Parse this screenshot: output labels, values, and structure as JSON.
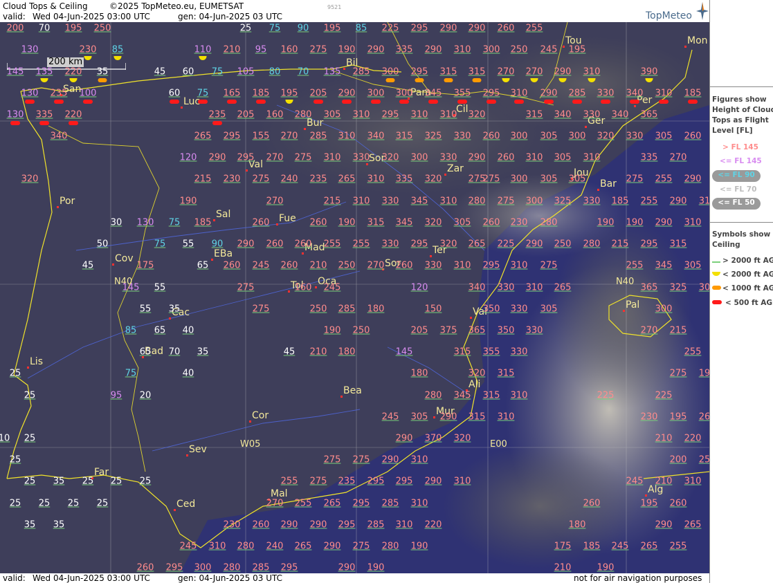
{
  "header": {
    "product": "Cloud Tops & Ceiling",
    "copyright": "©2025 TopMeteo.eu, EUMETSAT",
    "code": "9521",
    "valid_label": "valid:",
    "valid_time": "Wed  04-Jun-2025  03:00 UTC",
    "gen_time": "gen: 04-Jun-2025 03 UTC",
    "logo": "TopMeteo"
  },
  "footer": {
    "valid_label": "valid:",
    "valid_time": "Wed  04-Jun-2025  03:00 UTC",
    "gen_time": "gen: 04-Jun-2025 03 UTC",
    "disclaimer": "not for air navigation purposes"
  },
  "scale": {
    "label": "200 km"
  },
  "legend": {
    "figures_title": [
      "Figures show",
      "Height of Cloud",
      "Tops as Flight",
      "Level  [FL]"
    ],
    "figures": [
      {
        "label": "> FL 145",
        "color": "#ff8c8c"
      },
      {
        "label": "<= FL 145",
        "color": "#d88cf0"
      },
      {
        "label": "<= FL 90",
        "color": "#5fd4e6"
      },
      {
        "label": "<= FL 70",
        "color": "#dddddd"
      },
      {
        "label": "<= FL 50",
        "color": "#ffffff"
      }
    ],
    "symbols_title": [
      "Symbols show",
      "Ceiling"
    ],
    "symbols": [
      {
        "label": "> 2000 ft AGL",
        "kind": "line",
        "color": "#7bd07b"
      },
      {
        "label": "< 2000 ft AGL",
        "kind": "half-disc",
        "color": "#f3e000"
      },
      {
        "label": "< 1000 ft AGL",
        "kind": "bar",
        "color": "#ff9a00"
      },
      {
        "label": "< 500 ft AGL",
        "kind": "bar",
        "color": "#ff1a1a"
      }
    ]
  },
  "grid_labels": [
    "N40",
    "N40",
    "W05",
    "E00"
  ],
  "cities": [
    "Bil",
    "Pam",
    "San",
    "Luc",
    "Bur",
    "Cil",
    "Per",
    "Ger",
    "Mon",
    "Tou",
    "Sor",
    "Val",
    "Zar",
    "Jou",
    "Bar",
    "Por",
    "Sal",
    "Fue",
    "Mad",
    "EBa",
    "Cov",
    "Ter",
    "Sor",
    "Tol",
    "Oca",
    "Cac",
    "Val",
    "Pal",
    "Bad",
    "Lis",
    "Ali",
    "Bea",
    "Mur",
    "Cor",
    "Sev",
    "Far",
    "Mal",
    "Alg",
    "Ced"
  ],
  "flight_levels": [
    [
      "200",
      "pink"
    ],
    [
      "70",
      "white"
    ],
    [
      "195",
      "pink"
    ],
    [
      "250",
      "pink"
    ],
    [
      "25",
      "white"
    ],
    [
      "75",
      "cyan"
    ],
    [
      "90",
      "cyan"
    ],
    [
      "195",
      "pink"
    ],
    [
      "85",
      "cyan"
    ],
    [
      "225",
      "pink"
    ],
    [
      "295",
      "pink"
    ],
    [
      "290",
      "pink"
    ],
    [
      "290",
      "pink"
    ],
    [
      "260",
      "pink"
    ],
    [
      "255",
      "pink"
    ],
    [
      "130",
      "violet"
    ],
    [
      "230",
      "pink"
    ],
    [
      "85",
      "cyan"
    ],
    [
      "110",
      "violet"
    ],
    [
      "210",
      "pink"
    ],
    [
      "95",
      "violet"
    ],
    [
      "160",
      "pink"
    ],
    [
      "275",
      "pink"
    ],
    [
      "190",
      "pink"
    ],
    [
      "290",
      "pink"
    ],
    [
      "335",
      "pink"
    ],
    [
      "290",
      "pink"
    ],
    [
      "310",
      "pink"
    ],
    [
      "300",
      "pink"
    ],
    [
      "250",
      "pink"
    ],
    [
      "245",
      "pink"
    ],
    [
      "195",
      "pink"
    ],
    [
      "145",
      "violet"
    ],
    [
      "135",
      "violet"
    ],
    [
      "220",
      "pink"
    ],
    [
      "35",
      "white"
    ],
    [
      "45",
      "white"
    ],
    [
      "60",
      "white"
    ],
    [
      "75",
      "cyan"
    ],
    [
      "105",
      "violet"
    ],
    [
      "80",
      "cyan"
    ],
    [
      "70",
      "cyan"
    ],
    [
      "135",
      "violet"
    ],
    [
      "285",
      "pink"
    ],
    [
      "300",
      "pink"
    ],
    [
      "295",
      "pink"
    ],
    [
      "315",
      "pink"
    ],
    [
      "315",
      "pink"
    ],
    [
      "270",
      "pink"
    ],
    [
      "270",
      "pink"
    ],
    [
      "290",
      "pink"
    ],
    [
      "310",
      "pink"
    ],
    [
      "390",
      "pink"
    ],
    [
      "130",
      "violet"
    ],
    [
      "235",
      "pink"
    ],
    [
      "100",
      "violet"
    ],
    [
      "60",
      "white"
    ],
    [
      "75",
      "cyan"
    ],
    [
      "165",
      "pink"
    ],
    [
      "185",
      "pink"
    ],
    [
      "195",
      "pink"
    ],
    [
      "205",
      "pink"
    ],
    [
      "290",
      "pink"
    ],
    [
      "300",
      "pink"
    ],
    [
      "300",
      "pink"
    ],
    [
      "345",
      "pink"
    ],
    [
      "355",
      "pink"
    ],
    [
      "295",
      "pink"
    ],
    [
      "310",
      "pink"
    ],
    [
      "290",
      "pink"
    ],
    [
      "285",
      "pink"
    ],
    [
      "330",
      "pink"
    ],
    [
      "340",
      "pink"
    ],
    [
      "310",
      "pink"
    ],
    [
      "185",
      "pink"
    ],
    [
      "130",
      "violet"
    ],
    [
      "335",
      "pink"
    ],
    [
      "220",
      "pink"
    ],
    [
      "235",
      "pink"
    ],
    [
      "205",
      "pink"
    ],
    [
      "160",
      "pink"
    ],
    [
      "280",
      "pink"
    ],
    [
      "305",
      "pink"
    ],
    [
      "310",
      "pink"
    ],
    [
      "295",
      "pink"
    ],
    [
      "310",
      "pink"
    ],
    [
      "310",
      "pink"
    ],
    [
      "320",
      "pink"
    ],
    [
      "315",
      "pink"
    ],
    [
      "340",
      "pink"
    ],
    [
      "330",
      "pink"
    ],
    [
      "340",
      "pink"
    ],
    [
      "365",
      "pink"
    ],
    [
      "340",
      "pink"
    ],
    [
      "265",
      "pink"
    ],
    [
      "295",
      "pink"
    ],
    [
      "155",
      "pink"
    ],
    [
      "270",
      "pink"
    ],
    [
      "285",
      "pink"
    ],
    [
      "310",
      "pink"
    ],
    [
      "340",
      "pink"
    ],
    [
      "315",
      "pink"
    ],
    [
      "325",
      "pink"
    ],
    [
      "330",
      "pink"
    ],
    [
      "260",
      "pink"
    ],
    [
      "300",
      "pink"
    ],
    [
      "305",
      "pink"
    ],
    [
      "300",
      "pink"
    ],
    [
      "320",
      "pink"
    ],
    [
      "330",
      "pink"
    ],
    [
      "305",
      "pink"
    ],
    [
      "260",
      "pink"
    ],
    [
      "120",
      "violet"
    ],
    [
      "290",
      "pink"
    ],
    [
      "295",
      "pink"
    ],
    [
      "270",
      "pink"
    ],
    [
      "275",
      "pink"
    ],
    [
      "310",
      "pink"
    ],
    [
      "330",
      "pink"
    ],
    [
      "320",
      "pink"
    ],
    [
      "300",
      "pink"
    ],
    [
      "330",
      "pink"
    ],
    [
      "290",
      "pink"
    ],
    [
      "260",
      "pink"
    ],
    [
      "310",
      "pink"
    ],
    [
      "305",
      "pink"
    ],
    [
      "310",
      "pink"
    ],
    [
      "335",
      "pink"
    ],
    [
      "270",
      "pink"
    ],
    [
      "320",
      "pink"
    ],
    [
      "215",
      "pink"
    ],
    [
      "230",
      "pink"
    ],
    [
      "275",
      "pink"
    ],
    [
      "240",
      "pink"
    ],
    [
      "235",
      "pink"
    ],
    [
      "265",
      "pink"
    ],
    [
      "310",
      "pink"
    ],
    [
      "335",
      "pink"
    ],
    [
      "320",
      "pink"
    ],
    [
      "275",
      "pink"
    ],
    [
      "275",
      "pink"
    ],
    [
      "300",
      "pink"
    ],
    [
      "305",
      "pink"
    ],
    [
      "305",
      "pink"
    ],
    [
      "275",
      "pink"
    ],
    [
      "255",
      "pink"
    ],
    [
      "290",
      "pink"
    ],
    [
      "190",
      "pink"
    ],
    [
      "270",
      "pink"
    ],
    [
      "215",
      "pink"
    ],
    [
      "310",
      "pink"
    ],
    [
      "330",
      "pink"
    ],
    [
      "345",
      "pink"
    ],
    [
      "310",
      "pink"
    ],
    [
      "280",
      "pink"
    ],
    [
      "275",
      "pink"
    ],
    [
      "300",
      "pink"
    ],
    [
      "325",
      "pink"
    ],
    [
      "330",
      "pink"
    ],
    [
      "185",
      "pink"
    ],
    [
      "255",
      "pink"
    ],
    [
      "290",
      "pink"
    ],
    [
      "31",
      "pink"
    ],
    [
      "30",
      "white"
    ],
    [
      "130",
      "violet"
    ],
    [
      "75",
      "cyan"
    ],
    [
      "185",
      "pink"
    ],
    [
      "260",
      "pink"
    ],
    [
      "260",
      "pink"
    ],
    [
      "190",
      "pink"
    ],
    [
      "315",
      "pink"
    ],
    [
      "345",
      "pink"
    ],
    [
      "320",
      "pink"
    ],
    [
      "305",
      "pink"
    ],
    [
      "260",
      "pink"
    ],
    [
      "230",
      "pink"
    ],
    [
      "280",
      "pink"
    ],
    [
      "190",
      "pink"
    ],
    [
      "190",
      "pink"
    ],
    [
      "290",
      "pink"
    ],
    [
      "310",
      "pink"
    ],
    [
      "50",
      "white"
    ],
    [
      "75",
      "cyan"
    ],
    [
      "55",
      "white"
    ],
    [
      "90",
      "cyan"
    ],
    [
      "290",
      "pink"
    ],
    [
      "260",
      "pink"
    ],
    [
      "260",
      "pink"
    ],
    [
      "255",
      "pink"
    ],
    [
      "255",
      "pink"
    ],
    [
      "330",
      "pink"
    ],
    [
      "295",
      "pink"
    ],
    [
      "320",
      "pink"
    ],
    [
      "265",
      "pink"
    ],
    [
      "225",
      "pink"
    ],
    [
      "290",
      "pink"
    ],
    [
      "250",
      "pink"
    ],
    [
      "280",
      "pink"
    ],
    [
      "215",
      "pink"
    ],
    [
      "295",
      "pink"
    ],
    [
      "315",
      "pink"
    ],
    [
      "45",
      "white"
    ],
    [
      "175",
      "pink"
    ],
    [
      "65",
      "white"
    ],
    [
      "260",
      "pink"
    ],
    [
      "245",
      "pink"
    ],
    [
      "260",
      "pink"
    ],
    [
      "210",
      "pink"
    ],
    [
      "250",
      "pink"
    ],
    [
      "270",
      "pink"
    ],
    [
      "260",
      "pink"
    ],
    [
      "330",
      "pink"
    ],
    [
      "310",
      "pink"
    ],
    [
      "295",
      "pink"
    ],
    [
      "310",
      "pink"
    ],
    [
      "275",
      "pink"
    ],
    [
      "255",
      "pink"
    ],
    [
      "345",
      "pink"
    ],
    [
      "305",
      "pink"
    ],
    [
      "145",
      "violet"
    ],
    [
      "55",
      "white"
    ],
    [
      "275",
      "pink"
    ],
    [
      "160",
      "pink"
    ],
    [
      "245",
      "pink"
    ],
    [
      "120",
      "violet"
    ],
    [
      "340",
      "pink"
    ],
    [
      "330",
      "pink"
    ],
    [
      "310",
      "pink"
    ],
    [
      "265",
      "pink"
    ],
    [
      "365",
      "pink"
    ],
    [
      "325",
      "pink"
    ],
    [
      "30",
      "pink"
    ],
    [
      "55",
      "white"
    ],
    [
      "35",
      "white"
    ],
    [
      "275",
      "pink"
    ],
    [
      "250",
      "pink"
    ],
    [
      "285",
      "pink"
    ],
    [
      "180",
      "pink"
    ],
    [
      "150",
      "pink"
    ],
    [
      "350",
      "pink"
    ],
    [
      "330",
      "pink"
    ],
    [
      "305",
      "pink"
    ],
    [
      "300",
      "pink"
    ],
    [
      "85",
      "cyan"
    ],
    [
      "65",
      "white"
    ],
    [
      "40",
      "white"
    ],
    [
      "190",
      "pink"
    ],
    [
      "250",
      "pink"
    ],
    [
      "205",
      "pink"
    ],
    [
      "375",
      "pink"
    ],
    [
      "365",
      "pink"
    ],
    [
      "350",
      "pink"
    ],
    [
      "330",
      "pink"
    ],
    [
      "270",
      "pink"
    ],
    [
      "215",
      "pink"
    ],
    [
      "65",
      "white"
    ],
    [
      "70",
      "white"
    ],
    [
      "35",
      "white"
    ],
    [
      "45",
      "white"
    ],
    [
      "210",
      "pink"
    ],
    [
      "180",
      "pink"
    ],
    [
      "145",
      "violet"
    ],
    [
      "315",
      "pink"
    ],
    [
      "355",
      "pink"
    ],
    [
      "330",
      "pink"
    ],
    [
      "255",
      "pink"
    ],
    [
      "25",
      "white"
    ],
    [
      "75",
      "cyan"
    ],
    [
      "40",
      "white"
    ],
    [
      "180",
      "pink"
    ],
    [
      "320",
      "pink"
    ],
    [
      "315",
      "pink"
    ],
    [
      "275",
      "pink"
    ],
    [
      "19",
      "pink"
    ],
    [
      "25",
      "white"
    ],
    [
      "95",
      "violet"
    ],
    [
      "20",
      "white"
    ],
    [
      "280",
      "pink"
    ],
    [
      "345",
      "pink"
    ],
    [
      "315",
      "pink"
    ],
    [
      "310",
      "pink"
    ],
    [
      "225",
      "pink"
    ],
    [
      "225",
      "pink"
    ],
    [
      "245",
      "pink"
    ],
    [
      "305",
      "pink"
    ],
    [
      "290",
      "pink"
    ],
    [
      "315",
      "pink"
    ],
    [
      "310",
      "pink"
    ],
    [
      "230",
      "pink"
    ],
    [
      "195",
      "pink"
    ],
    [
      "26",
      "pink"
    ],
    [
      "10",
      "white"
    ],
    [
      "25",
      "white"
    ],
    [
      "290",
      "pink"
    ],
    [
      "370",
      "pink"
    ],
    [
      "320",
      "pink"
    ],
    [
      "210",
      "pink"
    ],
    [
      "220",
      "pink"
    ],
    [
      "25",
      "white"
    ],
    [
      "275",
      "pink"
    ],
    [
      "275",
      "pink"
    ],
    [
      "290",
      "pink"
    ],
    [
      "310",
      "pink"
    ],
    [
      "200",
      "pink"
    ],
    [
      "25",
      "pink"
    ],
    [
      "25",
      "white"
    ],
    [
      "35",
      "white"
    ],
    [
      "25",
      "white"
    ],
    [
      "25",
      "white"
    ],
    [
      "25",
      "white"
    ],
    [
      "255",
      "pink"
    ],
    [
      "275",
      "pink"
    ],
    [
      "235",
      "pink"
    ],
    [
      "295",
      "pink"
    ],
    [
      "295",
      "pink"
    ],
    [
      "290",
      "pink"
    ],
    [
      "310",
      "pink"
    ],
    [
      "245",
      "pink"
    ],
    [
      "210",
      "pink"
    ],
    [
      "310",
      "pink"
    ],
    [
      "25",
      "white"
    ],
    [
      "25",
      "white"
    ],
    [
      "25",
      "white"
    ],
    [
      "25",
      "white"
    ],
    [
      "270",
      "pink"
    ],
    [
      "255",
      "pink"
    ],
    [
      "265",
      "pink"
    ],
    [
      "295",
      "pink"
    ],
    [
      "285",
      "pink"
    ],
    [
      "310",
      "pink"
    ],
    [
      "260",
      "pink"
    ],
    [
      "195",
      "pink"
    ],
    [
      "260",
      "pink"
    ],
    [
      "35",
      "white"
    ],
    [
      "35",
      "white"
    ],
    [
      "230",
      "pink"
    ],
    [
      "260",
      "pink"
    ],
    [
      "290",
      "pink"
    ],
    [
      "290",
      "pink"
    ],
    [
      "295",
      "pink"
    ],
    [
      "285",
      "pink"
    ],
    [
      "310",
      "pink"
    ],
    [
      "220",
      "pink"
    ],
    [
      "180",
      "pink"
    ],
    [
      "290",
      "pink"
    ],
    [
      "265",
      "pink"
    ],
    [
      "245",
      "pink"
    ],
    [
      "310",
      "pink"
    ],
    [
      "280",
      "pink"
    ],
    [
      "240",
      "pink"
    ],
    [
      "265",
      "pink"
    ],
    [
      "290",
      "pink"
    ],
    [
      "275",
      "pink"
    ],
    [
      "280",
      "pink"
    ],
    [
      "190",
      "pink"
    ],
    [
      "175",
      "pink"
    ],
    [
      "185",
      "pink"
    ],
    [
      "245",
      "pink"
    ],
    [
      "265",
      "pink"
    ],
    [
      "255",
      "pink"
    ],
    [
      "260",
      "pink"
    ],
    [
      "295",
      "pink"
    ],
    [
      "300",
      "pink"
    ],
    [
      "280",
      "pink"
    ],
    [
      "285",
      "pink"
    ],
    [
      "295",
      "pink"
    ],
    [
      "290",
      "pink"
    ],
    [
      "190",
      "pink"
    ],
    [
      "210",
      "pink"
    ],
    [
      "190",
      "pink"
    ]
  ]
}
